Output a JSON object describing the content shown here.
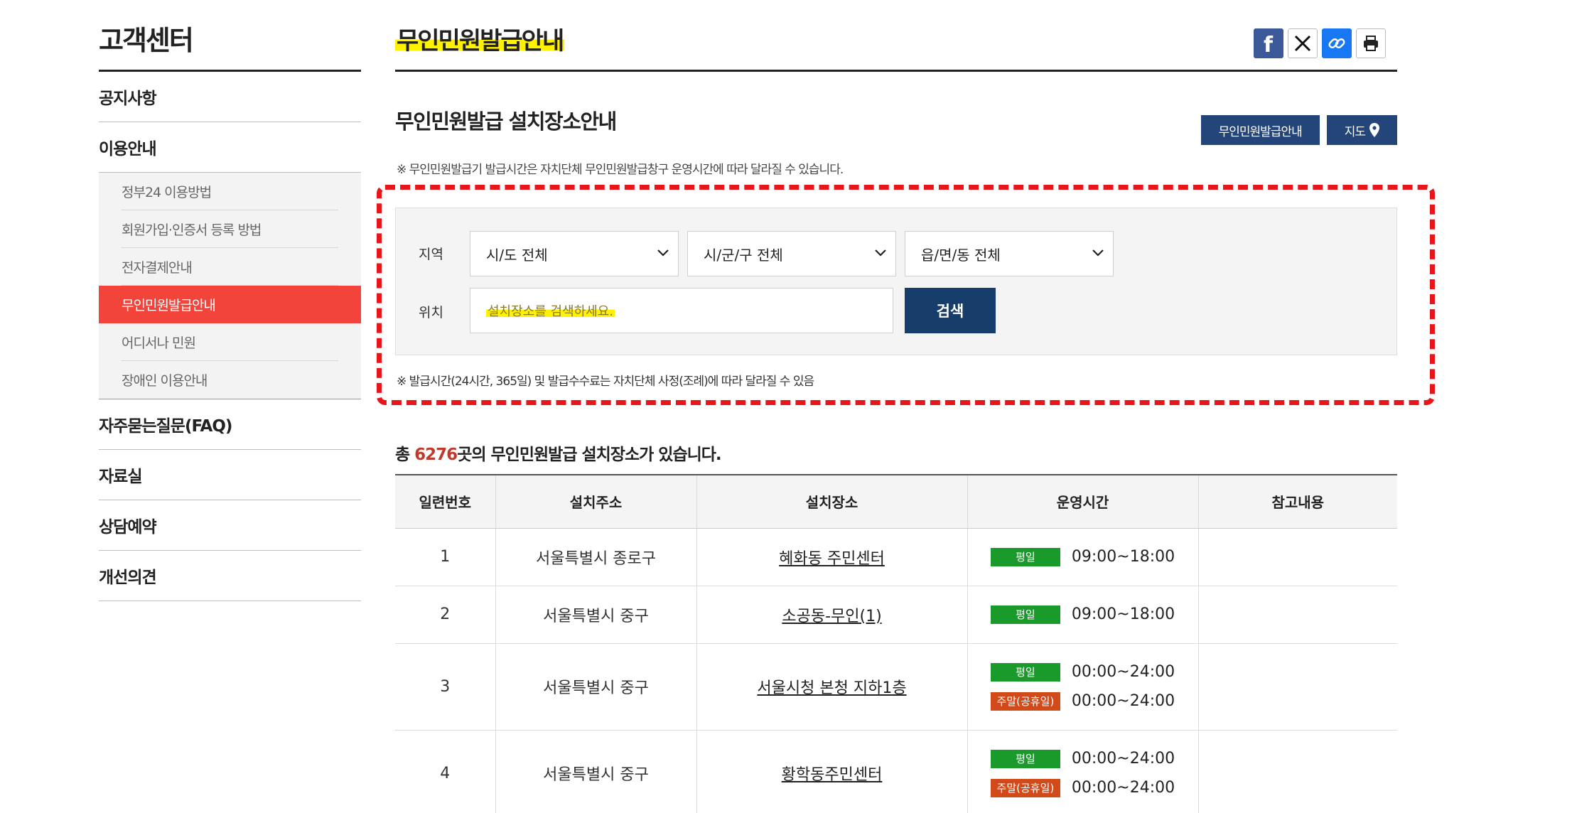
{
  "sidebar": {
    "title": "고객센터",
    "items": [
      {
        "label": "공지사항"
      },
      {
        "label": "이용안내"
      },
      {
        "label": "자주묻는질문(FAQ)"
      },
      {
        "label": "자료실"
      },
      {
        "label": "상담예약"
      },
      {
        "label": "개선의견"
      }
    ],
    "sub_items": [
      {
        "label": "정부24 이용방법"
      },
      {
        "label": "회원가입·인증서 등록 방법"
      },
      {
        "label": "전자결제안내"
      },
      {
        "label": "무인민원발급안내"
      },
      {
        "label": "어디서나 민원"
      },
      {
        "label": "장애인 이용안내"
      }
    ]
  },
  "header": {
    "title": "무인민원발급안내"
  },
  "section": {
    "title": "무인민원발급 설치장소안내",
    "guide_button": "무인민원발급안내",
    "map_button": "지도",
    "note_top": "※ 무인민원발급기 발급시간은 자치단체 무인민원발급창구 운영시간에 따라 달라질 수 있습니다."
  },
  "search": {
    "region_label": "지역",
    "location_label": "위치",
    "sido": "시/도 전체",
    "sigungu": "시/군/구 전체",
    "dong": "읍/면/동 전체",
    "placeholder": "설치장소를 검색하세요.",
    "button": "검색",
    "note": "※ 발급시간(24시간, 365일) 및 발급수수료는 자치단체 사정(조례)에 따라 달라질 수 있음"
  },
  "summary": {
    "prefix": "총 ",
    "count": "6276",
    "suffix": "곳의 무인민원발급 설치장소가 있습니다."
  },
  "colors": {
    "accent_red": "#f2443a",
    "navy": "#23457a",
    "weekday_badge": "#1a9a2a",
    "weekend_badge": "#d2491a"
  },
  "table": {
    "headers": [
      "일련번호",
      "설치주소",
      "설치장소",
      "운영시간",
      "참고내용"
    ],
    "rows": [
      {
        "no": "1",
        "address": "서울특별시 종로구",
        "place": "혜화동 주민센터",
        "hours": [
          {
            "type": "평일",
            "time": "09:00~18:00"
          }
        ],
        "note": ""
      },
      {
        "no": "2",
        "address": "서울특별시 중구",
        "place": "소공동-무인(1)",
        "hours": [
          {
            "type": "평일",
            "time": "09:00~18:00"
          }
        ],
        "note": ""
      },
      {
        "no": "3",
        "address": "서울특별시 중구",
        "place": "서울시청 본청 지하1층",
        "hours": [
          {
            "type": "평일",
            "time": "00:00~24:00"
          },
          {
            "type": "주말(공휴일)",
            "time": "00:00~24:00"
          }
        ],
        "note": ""
      },
      {
        "no": "4",
        "address": "서울특별시 중구",
        "place": "황학동주민센터",
        "hours": [
          {
            "type": "평일",
            "time": "00:00~24:00"
          },
          {
            "type": "주말(공휴일)",
            "time": "00:00~24:00"
          }
        ],
        "note": ""
      }
    ]
  }
}
